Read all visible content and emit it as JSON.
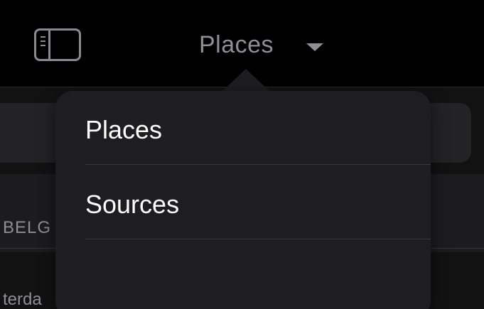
{
  "navbar": {
    "title": "Places",
    "sidebar_toggle_icon": "sidebar-toggle-icon",
    "dropdown_icon": "chevron-down-icon"
  },
  "background": {
    "section_header": "BELG",
    "row_text": "terda"
  },
  "menu": {
    "items": [
      {
        "label": "Places"
      },
      {
        "label": "Sources"
      }
    ]
  },
  "colors": {
    "background": "#000000",
    "popover": "#1e1e20",
    "secondary_text": "#8e8e93",
    "primary_text": "#ffffff"
  }
}
